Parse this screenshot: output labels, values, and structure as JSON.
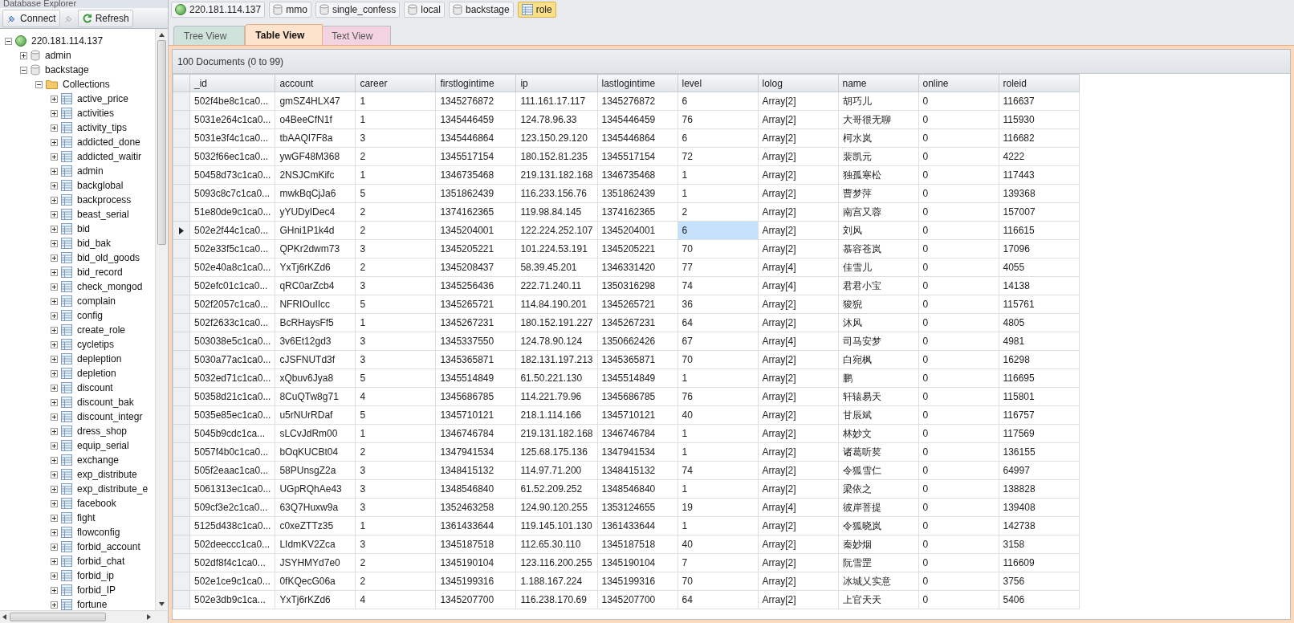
{
  "explorer": {
    "title": "Database Explorer",
    "connect": "Connect",
    "refresh": "Refresh",
    "tree": [
      {
        "label": "220.181.114.137",
        "kind": "server",
        "expanded": true,
        "children": [
          {
            "label": "admin",
            "kind": "database",
            "expanded": false
          },
          {
            "label": "backstage",
            "kind": "database",
            "expanded": true,
            "children": [
              {
                "label": "Collections",
                "kind": "folder",
                "expanded": true,
                "children": [
                  {
                    "label": "active_price",
                    "kind": "collection",
                    "expanded": false
                  },
                  {
                    "label": "activities",
                    "kind": "collection",
                    "expanded": false
                  },
                  {
                    "label": "activity_tips",
                    "kind": "collection",
                    "expanded": false
                  },
                  {
                    "label": "addicted_done",
                    "kind": "collection",
                    "expanded": false
                  },
                  {
                    "label": "addicted_waitir",
                    "kind": "collection",
                    "expanded": false
                  },
                  {
                    "label": "admin",
                    "kind": "collection",
                    "expanded": false
                  },
                  {
                    "label": "backglobal",
                    "kind": "collection",
                    "expanded": false
                  },
                  {
                    "label": "backprocess",
                    "kind": "collection",
                    "expanded": false
                  },
                  {
                    "label": "beast_serial",
                    "kind": "collection",
                    "expanded": false
                  },
                  {
                    "label": "bid",
                    "kind": "collection",
                    "expanded": false
                  },
                  {
                    "label": "bid_bak",
                    "kind": "collection",
                    "expanded": false
                  },
                  {
                    "label": "bid_old_goods",
                    "kind": "collection",
                    "expanded": false
                  },
                  {
                    "label": "bid_record",
                    "kind": "collection",
                    "expanded": false
                  },
                  {
                    "label": "check_mongod",
                    "kind": "collection",
                    "expanded": false
                  },
                  {
                    "label": "complain",
                    "kind": "collection",
                    "expanded": false
                  },
                  {
                    "label": "config",
                    "kind": "collection",
                    "expanded": false
                  },
                  {
                    "label": "create_role",
                    "kind": "collection",
                    "expanded": false
                  },
                  {
                    "label": "cycletips",
                    "kind": "collection",
                    "expanded": false
                  },
                  {
                    "label": "depleption",
                    "kind": "collection",
                    "expanded": false
                  },
                  {
                    "label": "depletion",
                    "kind": "collection",
                    "expanded": false
                  },
                  {
                    "label": "discount",
                    "kind": "collection",
                    "expanded": false
                  },
                  {
                    "label": "discount_bak",
                    "kind": "collection",
                    "expanded": false
                  },
                  {
                    "label": "discount_integr",
                    "kind": "collection",
                    "expanded": false
                  },
                  {
                    "label": "dress_shop",
                    "kind": "collection",
                    "expanded": false
                  },
                  {
                    "label": "equip_serial",
                    "kind": "collection",
                    "expanded": false
                  },
                  {
                    "label": "exchange",
                    "kind": "collection",
                    "expanded": false
                  },
                  {
                    "label": "exp_distribute",
                    "kind": "collection",
                    "expanded": false
                  },
                  {
                    "label": "exp_distribute_e",
                    "kind": "collection",
                    "expanded": false
                  },
                  {
                    "label": "facebook",
                    "kind": "collection",
                    "expanded": false
                  },
                  {
                    "label": "fight",
                    "kind": "collection",
                    "expanded": false
                  },
                  {
                    "label": "flowconfig",
                    "kind": "collection",
                    "expanded": false
                  },
                  {
                    "label": "forbid_account",
                    "kind": "collection",
                    "expanded": false
                  },
                  {
                    "label": "forbid_chat",
                    "kind": "collection",
                    "expanded": false
                  },
                  {
                    "label": "forbid_ip",
                    "kind": "collection",
                    "expanded": false
                  },
                  {
                    "label": "forbid_IP",
                    "kind": "collection",
                    "expanded": false
                  },
                  {
                    "label": "fortune",
                    "kind": "collection",
                    "expanded": false
                  }
                ]
              }
            ]
          }
        ]
      }
    ]
  },
  "breadcrumb": [
    {
      "label": "220.181.114.137",
      "kind": "server",
      "selected": false
    },
    {
      "label": "mmo",
      "kind": "database",
      "selected": false
    },
    {
      "label": "single_confess",
      "kind": "database",
      "selected": false
    },
    {
      "label": "local",
      "kind": "database",
      "selected": false
    },
    {
      "label": "backstage",
      "kind": "database",
      "selected": false
    },
    {
      "label": "role",
      "kind": "collection",
      "selected": true
    }
  ],
  "tabs": [
    {
      "label": "Tree View",
      "selected": false,
      "color": "#cfe3dc"
    },
    {
      "label": "Table View",
      "selected": true,
      "color": "#fde3cc"
    },
    {
      "label": "Text View",
      "selected": false,
      "color": "#f3d3e0"
    }
  ],
  "table": {
    "summary": "100 Documents (0 to 99)",
    "columns": [
      "_id",
      "account",
      "career",
      "firstlogintime",
      "ip",
      "lastlogintime",
      "level",
      "lolog",
      "name",
      "online",
      "roleid"
    ],
    "rows": [
      {
        "selected": false,
        "cells": [
          {
            "text": "502f4be8c1ca0...",
            "focused": false
          },
          {
            "text": "gmSZ4HLX47",
            "focused": false
          },
          {
            "text": "1",
            "focused": false
          },
          {
            "text": "1345276872",
            "focused": false
          },
          {
            "text": "111.161.17.117",
            "focused": false
          },
          {
            "text": "1345276872",
            "focused": false
          },
          {
            "text": "6",
            "focused": false
          },
          {
            "text": "Array[2]",
            "focused": false
          },
          {
            "text": "胡巧儿",
            "focused": false
          },
          {
            "text": "0",
            "focused": false
          },
          {
            "text": "116637",
            "focused": false
          }
        ]
      },
      {
        "selected": false,
        "cells": [
          {
            "text": "5031e264c1ca0...",
            "focused": false
          },
          {
            "text": "o4BeeCfN1f",
            "focused": false
          },
          {
            "text": "1",
            "focused": false
          },
          {
            "text": "1345446459",
            "focused": false
          },
          {
            "text": "124.78.96.33",
            "focused": false
          },
          {
            "text": "1345446459",
            "focused": false
          },
          {
            "text": "76",
            "focused": false
          },
          {
            "text": "Array[2]",
            "focused": false
          },
          {
            "text": "大哥很无聊",
            "focused": false
          },
          {
            "text": "0",
            "focused": false
          },
          {
            "text": "115930",
            "focused": false
          }
        ]
      },
      {
        "selected": false,
        "cells": [
          {
            "text": "5031e3f4c1ca0...",
            "focused": false
          },
          {
            "text": "tbAAQI7F8a",
            "focused": false
          },
          {
            "text": "3",
            "focused": false
          },
          {
            "text": "1345446864",
            "focused": false
          },
          {
            "text": "123.150.29.120",
            "focused": false
          },
          {
            "text": "1345446864",
            "focused": false
          },
          {
            "text": "6",
            "focused": false
          },
          {
            "text": "Array[2]",
            "focused": false
          },
          {
            "text": "柯水岚",
            "focused": false
          },
          {
            "text": "0",
            "focused": false
          },
          {
            "text": "116682",
            "focused": false
          }
        ]
      },
      {
        "selected": false,
        "cells": [
          {
            "text": "5032f66ec1ca0...",
            "focused": false
          },
          {
            "text": "ywGF48M368",
            "focused": false
          },
          {
            "text": "2",
            "focused": false
          },
          {
            "text": "1345517154",
            "focused": false
          },
          {
            "text": "180.152.81.235",
            "focused": false
          },
          {
            "text": "1345517154",
            "focused": false
          },
          {
            "text": "72",
            "focused": false
          },
          {
            "text": "Array[2]",
            "focused": false
          },
          {
            "text": "裴凯元",
            "focused": false
          },
          {
            "text": "0",
            "focused": false
          },
          {
            "text": "4222",
            "focused": false
          }
        ]
      },
      {
        "selected": false,
        "cells": [
          {
            "text": "50458d73c1ca0...",
            "focused": false
          },
          {
            "text": "2NSJCmKifc",
            "focused": false
          },
          {
            "text": "1",
            "focused": false
          },
          {
            "text": "1346735468",
            "focused": false
          },
          {
            "text": "219.131.182.168",
            "focused": false
          },
          {
            "text": "1346735468",
            "focused": false
          },
          {
            "text": "1",
            "focused": false
          },
          {
            "text": "Array[2]",
            "focused": false
          },
          {
            "text": "独孤寒松",
            "focused": false
          },
          {
            "text": "0",
            "focused": false
          },
          {
            "text": "117443",
            "focused": false
          }
        ]
      },
      {
        "selected": false,
        "cells": [
          {
            "text": "5093c8c7c1ca0...",
            "focused": false
          },
          {
            "text": "mwkBqCjJa6",
            "focused": false
          },
          {
            "text": "5",
            "focused": false
          },
          {
            "text": "1351862439",
            "focused": false
          },
          {
            "text": "116.233.156.76",
            "focused": false
          },
          {
            "text": "1351862439",
            "focused": false
          },
          {
            "text": "1",
            "focused": false
          },
          {
            "text": "Array[2]",
            "focused": false
          },
          {
            "text": "曹梦萍",
            "focused": false
          },
          {
            "text": "0",
            "focused": false
          },
          {
            "text": "139368",
            "focused": false
          }
        ]
      },
      {
        "selected": false,
        "cells": [
          {
            "text": "51e80de9c1ca0...",
            "focused": false
          },
          {
            "text": "yYUDyIDec4",
            "focused": false
          },
          {
            "text": "2",
            "focused": false
          },
          {
            "text": "1374162365",
            "focused": false
          },
          {
            "text": "119.98.84.145",
            "focused": false
          },
          {
            "text": "1374162365",
            "focused": false
          },
          {
            "text": "2",
            "focused": false
          },
          {
            "text": "Array[2]",
            "focused": false
          },
          {
            "text": "南宫又蓉",
            "focused": false
          },
          {
            "text": "0",
            "focused": false
          },
          {
            "text": "157007",
            "focused": false
          }
        ]
      },
      {
        "selected": true,
        "cells": [
          {
            "text": "502e2f44c1ca0...",
            "focused": false
          },
          {
            "text": "GHni1P1k4d",
            "focused": false
          },
          {
            "text": "2",
            "focused": false
          },
          {
            "text": "1345204001",
            "focused": false
          },
          {
            "text": "122.224.252.107",
            "focused": false
          },
          {
            "text": "1345204001",
            "focused": false
          },
          {
            "text": "6",
            "focused": true
          },
          {
            "text": "Array[2]",
            "focused": false
          },
          {
            "text": "刘风",
            "focused": false
          },
          {
            "text": "0",
            "focused": false
          },
          {
            "text": "116615",
            "focused": false
          }
        ]
      },
      {
        "selected": false,
        "cells": [
          {
            "text": "502e33f5c1ca0...",
            "focused": false
          },
          {
            "text": "QPKr2dwm73",
            "focused": false
          },
          {
            "text": "3",
            "focused": false
          },
          {
            "text": "1345205221",
            "focused": false
          },
          {
            "text": "101.224.53.191",
            "focused": false
          },
          {
            "text": "1345205221",
            "focused": false
          },
          {
            "text": "70",
            "focused": false
          },
          {
            "text": "Array[2]",
            "focused": false
          },
          {
            "text": "慕容苍岚",
            "focused": false
          },
          {
            "text": "0",
            "focused": false
          },
          {
            "text": "17096",
            "focused": false
          }
        ]
      },
      {
        "selected": false,
        "cells": [
          {
            "text": "502e40a8c1ca0...",
            "focused": false
          },
          {
            "text": "YxTj6rKZd6",
            "focused": false
          },
          {
            "text": "2",
            "focused": false
          },
          {
            "text": "1345208437",
            "focused": false
          },
          {
            "text": "58.39.45.201",
            "focused": false
          },
          {
            "text": "1346331420",
            "focused": false
          },
          {
            "text": "77",
            "focused": false
          },
          {
            "text": "Array[4]",
            "focused": false
          },
          {
            "text": "佳雪儿",
            "focused": false
          },
          {
            "text": "0",
            "focused": false
          },
          {
            "text": "4055",
            "focused": false
          }
        ]
      },
      {
        "selected": false,
        "cells": [
          {
            "text": "502efc01c1ca0...",
            "focused": false
          },
          {
            "text": "qRC0arZcb4",
            "focused": false
          },
          {
            "text": "3",
            "focused": false
          },
          {
            "text": "1345256436",
            "focused": false
          },
          {
            "text": "222.71.240.11",
            "focused": false
          },
          {
            "text": "1350316298",
            "focused": false
          },
          {
            "text": "74",
            "focused": false
          },
          {
            "text": "Array[4]",
            "focused": false
          },
          {
            "text": "君君小宝",
            "focused": false
          },
          {
            "text": "0",
            "focused": false
          },
          {
            "text": "14138",
            "focused": false
          }
        ]
      },
      {
        "selected": false,
        "cells": [
          {
            "text": "502f2057c1ca0...",
            "focused": false
          },
          {
            "text": "NFRIOuIIcc",
            "focused": false
          },
          {
            "text": "5",
            "focused": false
          },
          {
            "text": "1345265721",
            "focused": false
          },
          {
            "text": "114.84.190.201",
            "focused": false
          },
          {
            "text": "1345265721",
            "focused": false
          },
          {
            "text": "36",
            "focused": false
          },
          {
            "text": "Array[2]",
            "focused": false
          },
          {
            "text": "狻猊",
            "focused": false
          },
          {
            "text": "0",
            "focused": false
          },
          {
            "text": "115761",
            "focused": false
          }
        ]
      },
      {
        "selected": false,
        "cells": [
          {
            "text": "502f2633c1ca0...",
            "focused": false
          },
          {
            "text": "BcRHaysFf5",
            "focused": false
          },
          {
            "text": "1",
            "focused": false
          },
          {
            "text": "1345267231",
            "focused": false
          },
          {
            "text": "180.152.191.227",
            "focused": false
          },
          {
            "text": "1345267231",
            "focused": false
          },
          {
            "text": "64",
            "focused": false
          },
          {
            "text": "Array[2]",
            "focused": false
          },
          {
            "text": "沐风",
            "focused": false
          },
          {
            "text": "0",
            "focused": false
          },
          {
            "text": "4805",
            "focused": false
          }
        ]
      },
      {
        "selected": false,
        "cells": [
          {
            "text": "503038e5c1ca0...",
            "focused": false
          },
          {
            "text": "3v6Et12gd3",
            "focused": false
          },
          {
            "text": "3",
            "focused": false
          },
          {
            "text": "1345337550",
            "focused": false
          },
          {
            "text": "124.78.90.124",
            "focused": false
          },
          {
            "text": "1350662426",
            "focused": false
          },
          {
            "text": "67",
            "focused": false
          },
          {
            "text": "Array[4]",
            "focused": false
          },
          {
            "text": "司马安梦",
            "focused": false
          },
          {
            "text": "0",
            "focused": false
          },
          {
            "text": "4981",
            "focused": false
          }
        ]
      },
      {
        "selected": false,
        "cells": [
          {
            "text": "5030a77ac1ca0...",
            "focused": false
          },
          {
            "text": "cJSFNUTd3f",
            "focused": false
          },
          {
            "text": "3",
            "focused": false
          },
          {
            "text": "1345365871",
            "focused": false
          },
          {
            "text": "182.131.197.213",
            "focused": false
          },
          {
            "text": "1345365871",
            "focused": false
          },
          {
            "text": "70",
            "focused": false
          },
          {
            "text": "Array[2]",
            "focused": false
          },
          {
            "text": "白宛枫",
            "focused": false
          },
          {
            "text": "0",
            "focused": false
          },
          {
            "text": "16298",
            "focused": false
          }
        ]
      },
      {
        "selected": false,
        "cells": [
          {
            "text": "5032ed71c1ca0...",
            "focused": false
          },
          {
            "text": "xQbuv6Jya8",
            "focused": false
          },
          {
            "text": "5",
            "focused": false
          },
          {
            "text": "1345514849",
            "focused": false
          },
          {
            "text": "61.50.221.130",
            "focused": false
          },
          {
            "text": "1345514849",
            "focused": false
          },
          {
            "text": "1",
            "focused": false
          },
          {
            "text": "Array[2]",
            "focused": false
          },
          {
            "text": "鹏",
            "focused": false
          },
          {
            "text": "0",
            "focused": false
          },
          {
            "text": "116695",
            "focused": false
          }
        ]
      },
      {
        "selected": false,
        "cells": [
          {
            "text": "50358d21c1ca0...",
            "focused": false
          },
          {
            "text": "8CuQTw8g71",
            "focused": false
          },
          {
            "text": "4",
            "focused": false
          },
          {
            "text": "1345686785",
            "focused": false
          },
          {
            "text": "114.221.79.96",
            "focused": false
          },
          {
            "text": "1345686785",
            "focused": false
          },
          {
            "text": "76",
            "focused": false
          },
          {
            "text": "Array[2]",
            "focused": false
          },
          {
            "text": "轩辕易天",
            "focused": false
          },
          {
            "text": "0",
            "focused": false
          },
          {
            "text": "115801",
            "focused": false
          }
        ]
      },
      {
        "selected": false,
        "cells": [
          {
            "text": "5035e85ec1ca0...",
            "focused": false
          },
          {
            "text": "u5rNUrRDaf",
            "focused": false
          },
          {
            "text": "5",
            "focused": false
          },
          {
            "text": "1345710121",
            "focused": false
          },
          {
            "text": "218.1.114.166",
            "focused": false
          },
          {
            "text": "1345710121",
            "focused": false
          },
          {
            "text": "40",
            "focused": false
          },
          {
            "text": "Array[2]",
            "focused": false
          },
          {
            "text": "甘辰斌",
            "focused": false
          },
          {
            "text": "0",
            "focused": false
          },
          {
            "text": "116757",
            "focused": false
          }
        ]
      },
      {
        "selected": false,
        "cells": [
          {
            "text": "5045b9cdc1ca...",
            "focused": false
          },
          {
            "text": "sLCvJdRm00",
            "focused": false
          },
          {
            "text": "1",
            "focused": false
          },
          {
            "text": "1346746784",
            "focused": false
          },
          {
            "text": "219.131.182.168",
            "focused": false
          },
          {
            "text": "1346746784",
            "focused": false
          },
          {
            "text": "1",
            "focused": false
          },
          {
            "text": "Array[2]",
            "focused": false
          },
          {
            "text": "林妙文",
            "focused": false
          },
          {
            "text": "0",
            "focused": false
          },
          {
            "text": "117569",
            "focused": false
          }
        ]
      },
      {
        "selected": false,
        "cells": [
          {
            "text": "5057f4b0c1ca0...",
            "focused": false
          },
          {
            "text": "bOqKUCBt04",
            "focused": false
          },
          {
            "text": "2",
            "focused": false
          },
          {
            "text": "1347941534",
            "focused": false
          },
          {
            "text": "125.68.175.136",
            "focused": false
          },
          {
            "text": "1347941534",
            "focused": false
          },
          {
            "text": "1",
            "focused": false
          },
          {
            "text": "Array[2]",
            "focused": false
          },
          {
            "text": "诸葛听荬",
            "focused": false
          },
          {
            "text": "0",
            "focused": false
          },
          {
            "text": "136155",
            "focused": false
          }
        ]
      },
      {
        "selected": false,
        "cells": [
          {
            "text": "505f2eaac1ca0...",
            "focused": false
          },
          {
            "text": "58PUnsgZ2a",
            "focused": false
          },
          {
            "text": "3",
            "focused": false
          },
          {
            "text": "1348415132",
            "focused": false
          },
          {
            "text": "114.97.71.200",
            "focused": false
          },
          {
            "text": "1348415132",
            "focused": false
          },
          {
            "text": "74",
            "focused": false
          },
          {
            "text": "Array[2]",
            "focused": false
          },
          {
            "text": "令狐雪仁",
            "focused": false
          },
          {
            "text": "0",
            "focused": false
          },
          {
            "text": "64997",
            "focused": false
          }
        ]
      },
      {
        "selected": false,
        "cells": [
          {
            "text": "5061313ec1ca0...",
            "focused": false
          },
          {
            "text": "UGpRQhAe43",
            "focused": false
          },
          {
            "text": "3",
            "focused": false
          },
          {
            "text": "1348546840",
            "focused": false
          },
          {
            "text": "61.52.209.252",
            "focused": false
          },
          {
            "text": "1348546840",
            "focused": false
          },
          {
            "text": "1",
            "focused": false
          },
          {
            "text": "Array[2]",
            "focused": false
          },
          {
            "text": "梁依之",
            "focused": false
          },
          {
            "text": "0",
            "focused": false
          },
          {
            "text": "138828",
            "focused": false
          }
        ]
      },
      {
        "selected": false,
        "cells": [
          {
            "text": "509cf3e2c1ca0...",
            "focused": false
          },
          {
            "text": "63Q7Huxw9a",
            "focused": false
          },
          {
            "text": "3",
            "focused": false
          },
          {
            "text": "1352463258",
            "focused": false
          },
          {
            "text": "124.90.120.255",
            "focused": false
          },
          {
            "text": "1353124655",
            "focused": false
          },
          {
            "text": "19",
            "focused": false
          },
          {
            "text": "Array[4]",
            "focused": false
          },
          {
            "text": "彼岸菩提",
            "focused": false
          },
          {
            "text": "0",
            "focused": false
          },
          {
            "text": "139408",
            "focused": false
          }
        ]
      },
      {
        "selected": false,
        "cells": [
          {
            "text": "5125d438c1ca0...",
            "focused": false
          },
          {
            "text": "c0xeZTTz35",
            "focused": false
          },
          {
            "text": "1",
            "focused": false
          },
          {
            "text": "1361433644",
            "focused": false
          },
          {
            "text": "119.145.101.130",
            "focused": false
          },
          {
            "text": "1361433644",
            "focused": false
          },
          {
            "text": "1",
            "focused": false
          },
          {
            "text": "Array[2]",
            "focused": false
          },
          {
            "text": "令狐晓岚",
            "focused": false
          },
          {
            "text": "0",
            "focused": false
          },
          {
            "text": "142738",
            "focused": false
          }
        ]
      },
      {
        "selected": false,
        "cells": [
          {
            "text": "502deeccc1ca0...",
            "focused": false
          },
          {
            "text": "LIdmKV2Zca",
            "focused": false
          },
          {
            "text": "3",
            "focused": false
          },
          {
            "text": "1345187518",
            "focused": false
          },
          {
            "text": "112.65.30.110",
            "focused": false
          },
          {
            "text": "1345187518",
            "focused": false
          },
          {
            "text": "40",
            "focused": false
          },
          {
            "text": "Array[2]",
            "focused": false
          },
          {
            "text": "秦妙烟",
            "focused": false
          },
          {
            "text": "0",
            "focused": false
          },
          {
            "text": "3158",
            "focused": false
          }
        ]
      },
      {
        "selected": false,
        "cells": [
          {
            "text": "502df8f4c1ca0...",
            "focused": false
          },
          {
            "text": "JSYHMYd7e0",
            "focused": false
          },
          {
            "text": "2",
            "focused": false
          },
          {
            "text": "1345190104",
            "focused": false
          },
          {
            "text": "123.116.200.255",
            "focused": false
          },
          {
            "text": "1345190104",
            "focused": false
          },
          {
            "text": "7",
            "focused": false
          },
          {
            "text": "Array[2]",
            "focused": false
          },
          {
            "text": "阮雪罡",
            "focused": false
          },
          {
            "text": "0",
            "focused": false
          },
          {
            "text": "116609",
            "focused": false
          }
        ]
      },
      {
        "selected": false,
        "cells": [
          {
            "text": "502e1ce9c1ca0...",
            "focused": false
          },
          {
            "text": "0fKQecG06a",
            "focused": false
          },
          {
            "text": "2",
            "focused": false
          },
          {
            "text": "1345199316",
            "focused": false
          },
          {
            "text": "1.188.167.224",
            "focused": false
          },
          {
            "text": "1345199316",
            "focused": false
          },
          {
            "text": "70",
            "focused": false
          },
          {
            "text": "Array[2]",
            "focused": false
          },
          {
            "text": "冰城乂实意",
            "focused": false
          },
          {
            "text": "0",
            "focused": false
          },
          {
            "text": "3756",
            "focused": false
          }
        ]
      },
      {
        "selected": false,
        "cells": [
          {
            "text": "502e3db9c1ca...",
            "focused": false
          },
          {
            "text": "YxTj6rKZd6",
            "focused": false
          },
          {
            "text": "4",
            "focused": false
          },
          {
            "text": "1345207700",
            "focused": false
          },
          {
            "text": "116.238.170.69",
            "focused": false
          },
          {
            "text": "1345207700",
            "focused": false
          },
          {
            "text": "64",
            "focused": false
          },
          {
            "text": "Array[2]",
            "focused": false
          },
          {
            "text": "上官天天",
            "focused": false
          },
          {
            "text": "0",
            "focused": false
          },
          {
            "text": "5406",
            "focused": false
          }
        ]
      }
    ]
  }
}
